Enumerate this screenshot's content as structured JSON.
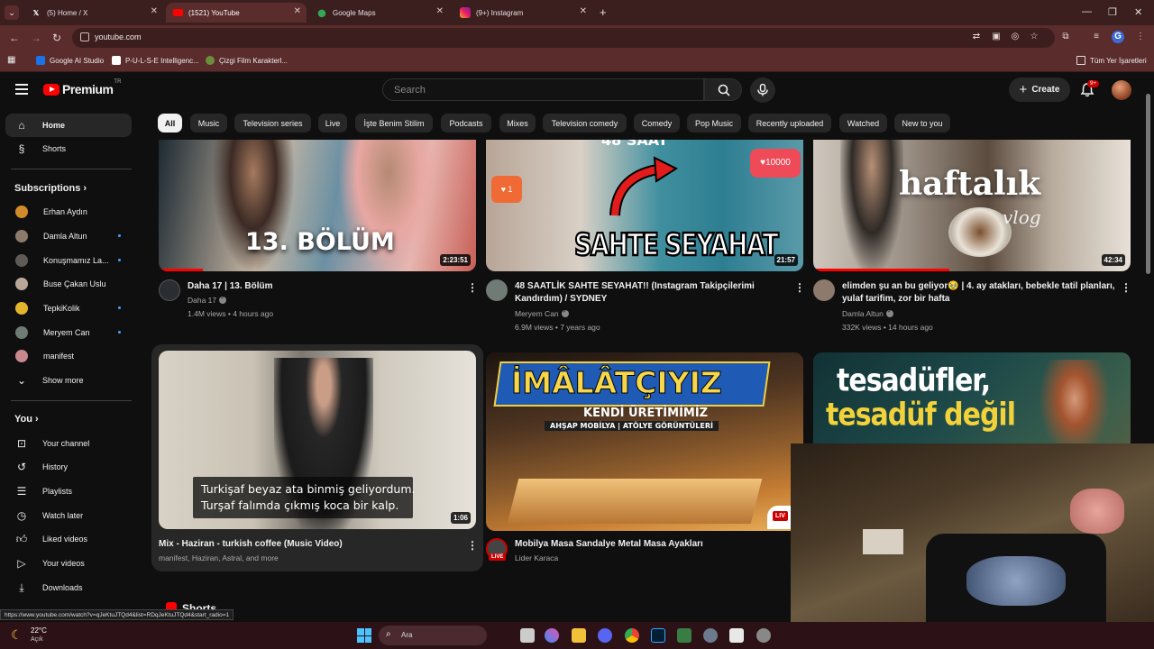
{
  "browser": {
    "tabs": [
      {
        "title": "(5) Home / X",
        "icon": "x-logo-icon"
      },
      {
        "title": "(1521) YouTube",
        "icon": "youtube-icon"
      },
      {
        "title": "Google Maps",
        "icon": "maps-pin-icon"
      },
      {
        "title": "(9+) Instagram",
        "icon": "instagram-icon"
      }
    ],
    "url": "youtube.com",
    "bookmarks": [
      "Google AI Studio",
      "P-U-L-S-E Intelligenc...",
      "Çizgi Film Karakterl..."
    ],
    "all_bookmarks": "Tüm Yer İşaretleri",
    "profile_initial": "G"
  },
  "yt": {
    "logo_word": "Premium",
    "logo_sup": "TR",
    "search_placeholder": "Search",
    "create_label": "Create",
    "notif_count": "9+",
    "chips": [
      "All",
      "Music",
      "Television series",
      "Live",
      "İşte Benim Stilim",
      "Podcasts",
      "Mixes",
      "Television comedy",
      "Comedy",
      "Pop Music",
      "Recently uploaded",
      "Watched",
      "New to you"
    ]
  },
  "sidebar": {
    "home": "Home",
    "shorts": "Shorts",
    "subscriptions_heading": "Subscriptions",
    "subscriptions": [
      "Erhan Aydın",
      "Damla Altun",
      "Konuşmamız La...",
      "Buse Çakan Uslu",
      "TepkiKolik",
      "Meryem Can",
      "manifest"
    ],
    "show_more": "Show more",
    "you_heading": "You",
    "you_items": [
      "Your channel",
      "History",
      "Playlists",
      "Watch later",
      "Liked videos",
      "Your videos",
      "Downloads"
    ]
  },
  "videos": [
    {
      "title": "Daha 17 | 13. Bölüm",
      "channel": "Daha 17",
      "meta": "1.4M views • 4 hours ago",
      "duration": "2:23:51",
      "overlay": "13. BÖLÜM"
    },
    {
      "title": "48 SAATLİK SAHTE SEYAHAT!! (Instagram Takipçilerimi Kandırdım) / SYDNEY",
      "channel": "Meryem Can",
      "meta": "6.9M views • 7 years ago",
      "duration": "21:57",
      "overlay": "SAHTE SEYAHAT",
      "overlay_top": "48 SAAT",
      "like_small": "1",
      "like_big": "10000"
    },
    {
      "title": "elimden şu an bu geliyor🥹 | 4. ay atakları, bebekle tatil planları, yulaf tarifim, zor bir hafta",
      "channel": "Damla Altun",
      "meta": "332K views • 14 hours ago",
      "duration": "42:34",
      "overlay": "haftalık",
      "overlay_sub": "vlog"
    },
    {
      "title": "Mix - Haziran - turkish coffee (Music Video)",
      "channel": "manifest, Haziran, Astral, and more",
      "duration": "1:06",
      "subtitle1": "Turkişaf beyaz ata binmiş geliyordum.",
      "subtitle2": "Turşaf falımda çıkmış koca bir kalp."
    },
    {
      "title": "Mobilya Masa Sandalye Metal Masa Ayakları",
      "channel": "Lider Karaca",
      "overlay": "İMÂLÂTÇIYIZ",
      "overlay_sub": "KENDİ ÜRETİMİMİZ",
      "overlay_sub2": "AHŞAP MOBİLYA | ATÖLYE GÖRÜNTÜLERİ",
      "live_badge": "LIVE",
      "live_corner": "LIV"
    },
    {
      "overlay": "tesadüfler,",
      "overlay_sub": "tesadüf değil"
    }
  ],
  "shorts_label": "Shorts",
  "status_url": "https://www.youtube.com/watch?v=qJeKtuJTQd4&list=RDqJeKtuJTQd4&start_radio=1",
  "taskbar": {
    "temp": "22°C",
    "condition": "Açık",
    "search": "Ara"
  },
  "colors": {
    "brand_red": "#ff0000",
    "bg": "#0f0f0f",
    "chrome": "#5a2c2c",
    "link_blue": "#3ea6ff"
  }
}
